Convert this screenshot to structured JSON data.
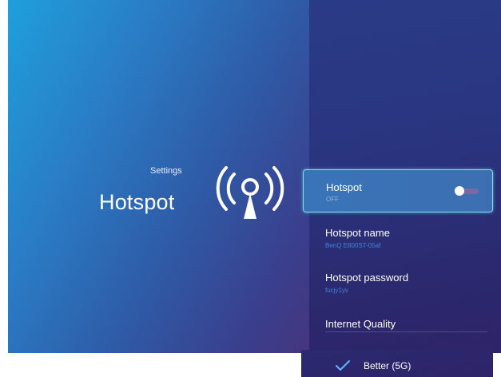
{
  "header": {
    "breadcrumb": "Settings",
    "title": "Hotspot"
  },
  "settings_list": {
    "hotspot": {
      "label": "Hotspot",
      "value": "OFF",
      "toggle_on": false
    },
    "hotspot_name": {
      "label": "Hotspot name",
      "value": "BenQ E800ST-05af"
    },
    "hotspot_password": {
      "label": "Hotspot password",
      "value": "fucjy1yv"
    },
    "internet_quality": {
      "label": "Internet Quality"
    }
  },
  "quality_options": [
    {
      "label": "Better (5G)",
      "selected": true
    }
  ],
  "icons": {
    "hotspot": "antenna-broadcast-icon",
    "selected": "checkmark-icon"
  },
  "colors": {
    "focus_border": "#7fe3f2",
    "sub_value": "#3f86d6"
  }
}
